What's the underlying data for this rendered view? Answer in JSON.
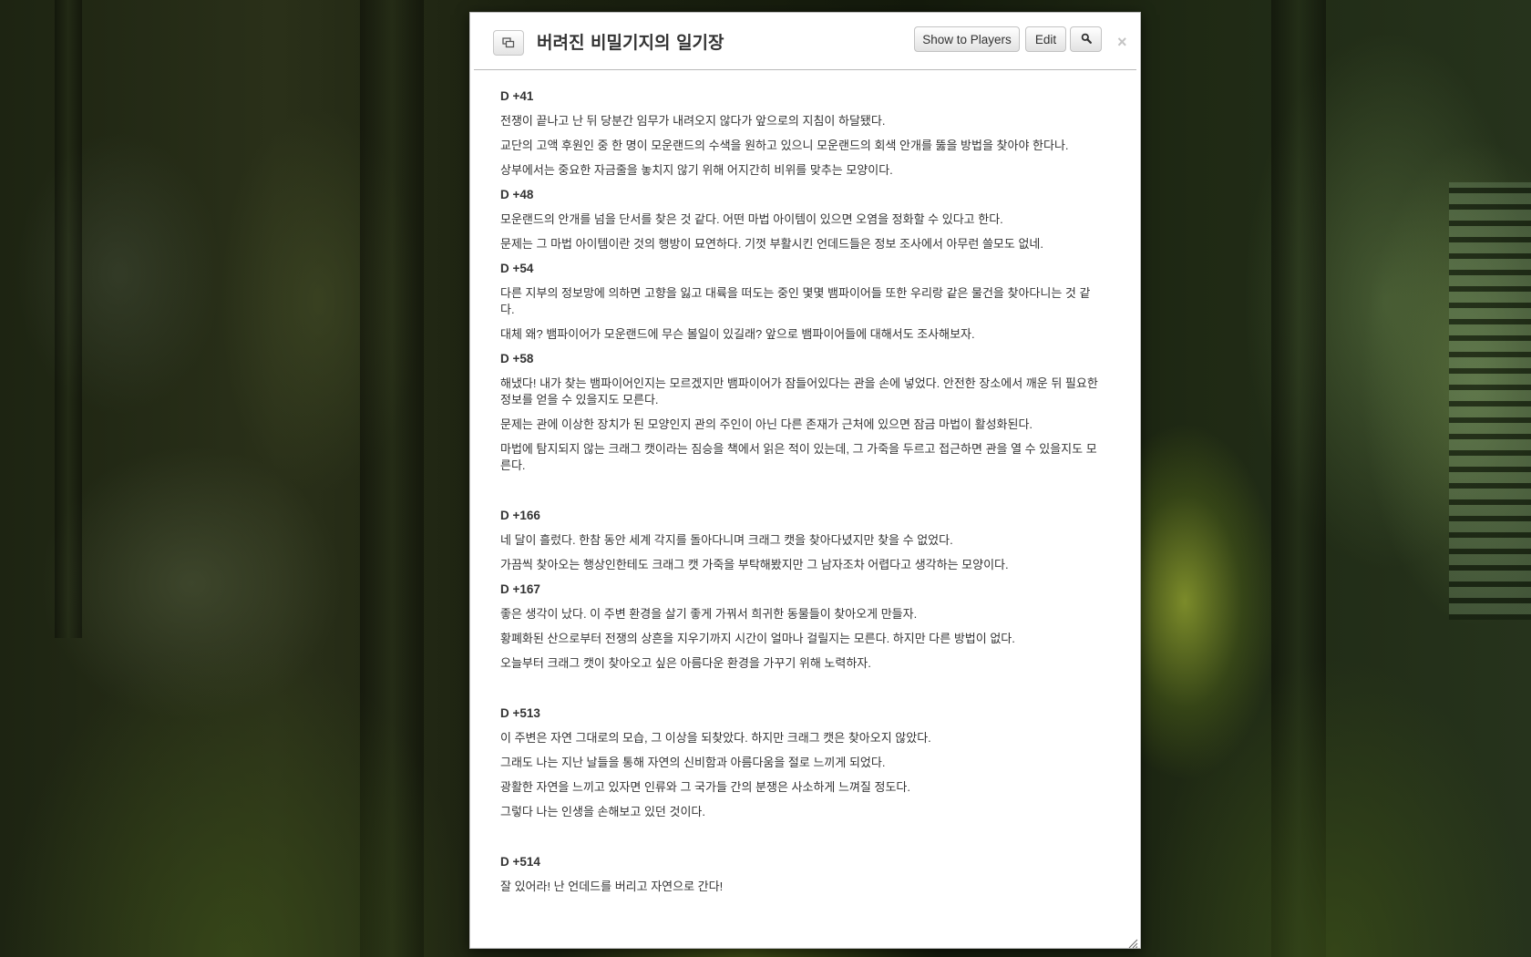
{
  "dialog": {
    "title": "버려진 비밀기지의 일기장",
    "buttons": {
      "show_to_players": "Show to Players",
      "edit": "Edit"
    },
    "close_glyph": "×"
  },
  "journal": [
    {
      "day": "D +41",
      "paragraphs": [
        "전쟁이 끝나고 난 뒤 당분간 임무가 내려오지 않다가 앞으로의 지침이 하달됐다.",
        "교단의 고액 후원인 중 한 명이 모운랜드의 수색을 원하고 있으니 모운랜드의 회색 안개를 뚫을 방법을 찾아야 한다나.",
        "상부에서는 중요한 자금줄을 놓치지 않기 위해 어지간히 비위를 맞추는 모양이다."
      ]
    },
    {
      "day": "D +48",
      "paragraphs": [
        "모운랜드의 안개를 넘을 단서를 찾은 것 같다. 어떤 마법 아이템이 있으면 오염을 정화할 수 있다고 한다.",
        "문제는 그 마법 아이템이란 것의 행방이 묘연하다. 기껏 부활시킨 언데드들은 정보 조사에서 아무런 쓸모도 없네."
      ]
    },
    {
      "day": "D +54",
      "paragraphs": [
        "다른 지부의 정보망에 의하면 고향을 잃고 대륙을 떠도는 중인 몇몇 뱀파이어들 또한 우리랑 같은 물건을 찾아다니는 것 같다.",
        "대체 왜? 뱀파이어가 모운랜드에 무슨 볼일이 있길래? 앞으로 뱀파이어들에 대해서도 조사해보자."
      ]
    },
    {
      "day": "D +58",
      "paragraphs": [
        "해냈다! 내가 찾는 뱀파이어인지는 모르겠지만 뱀파이어가 잠들어있다는 관을 손에 넣었다. 안전한 장소에서 깨운 뒤 필요한 정보를 얻을 수 있을지도 모른다.",
        "문제는 관에 이상한 장치가 된 모양인지 관의 주인이 아닌 다른 존재가 근처에 있으면 잠금 마법이 활성화된다.",
        "마법에 탐지되지 않는 크래그 캣이라는 짐승을 책에서 읽은 적이 있는데, 그 가죽을 두르고 접근하면 관을 열 수 있을지도 모른다."
      ]
    },
    {
      "day": "D +166",
      "paragraphs": [
        "네 달이 흘렀다. 한참 동안 세계 각지를 돌아다니며 크래그 캣을 찾아다녔지만 찾을 수 없었다.",
        "가끔씩 찾아오는 행상인한테도 크래그 캣 가죽을 부탁해봤지만 그 남자조차 어렵다고 생각하는 모양이다."
      ]
    },
    {
      "day": "D +167",
      "paragraphs": [
        "좋은 생각이 났다. 이 주변 환경을 살기 좋게 가꿔서 희귀한 동물들이 찾아오게 만들자.",
        "황폐화된 산으로부터 전쟁의 상흔을 지우기까지 시간이 얼마나 걸릴지는 모른다. 하지만 다른 방법이 없다.",
        "오늘부터 크래그 캣이 찾아오고 싶은 아름다운 환경을 가꾸기 위해 노력하자."
      ]
    },
    {
      "day": "D +513",
      "paragraphs": [
        "이 주변은 자연 그대로의 모습, 그 이상을 되찾았다. 하지만 크래그 캣은 찾아오지 않았다.",
        "그래도 나는 지난 날들을 통해 자연의 신비함과 아름다움을 절로 느끼게 되었다.",
        "광활한 자연을 느끼고 있자면 인류와 그 국가들 간의 분쟁은 사소하게 느껴질 정도다.",
        "그렇다 나는 인생을 손해보고 있던 것이다."
      ]
    },
    {
      "day": "D +514",
      "paragraphs": [
        "잘 있어라! 난 언데드를 버리고 자연으로 간다!"
      ]
    }
  ],
  "icons": {
    "popout": "popout-icon",
    "search": "search-icon",
    "resize": "resize-grip-icon"
  }
}
